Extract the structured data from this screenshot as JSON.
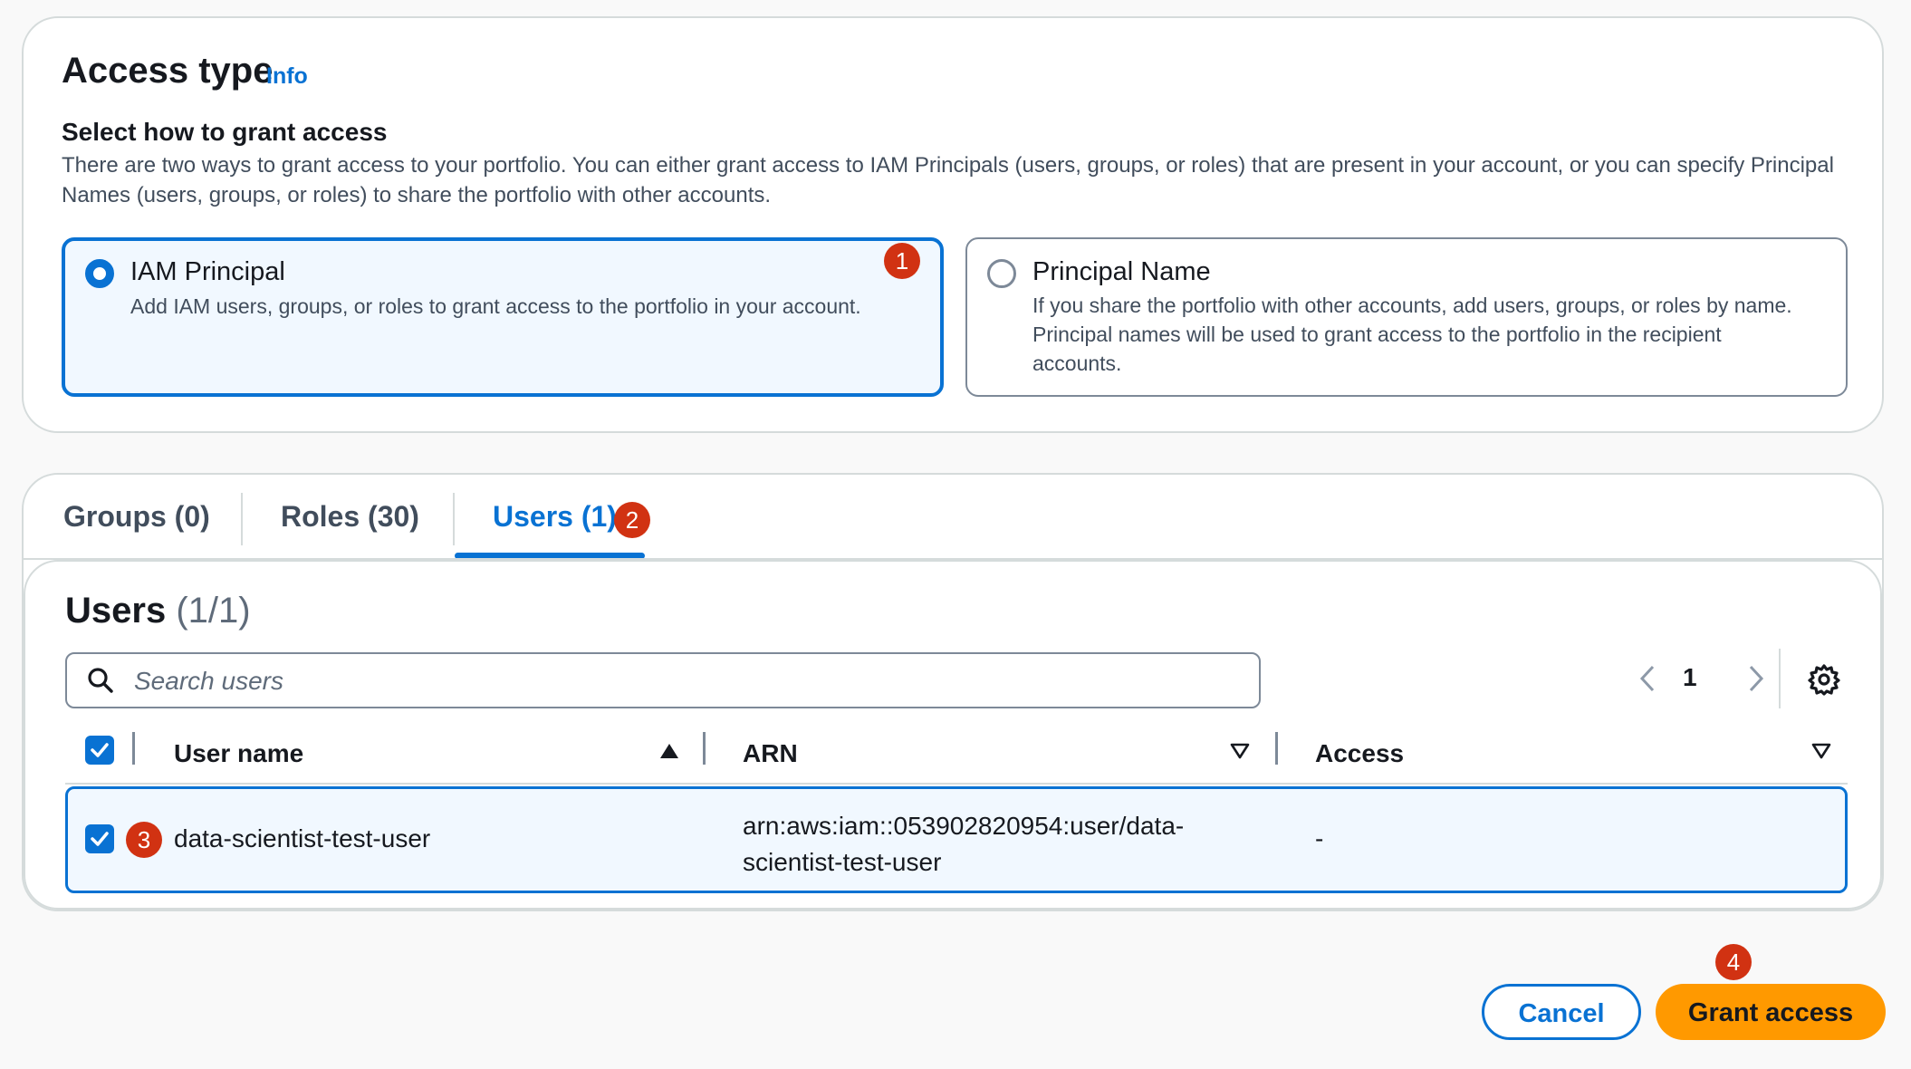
{
  "access_type": {
    "title": "Access type",
    "info_link": "Info",
    "heading": "Select how to grant access",
    "description": "There are two ways to grant access to your portfolio. You can either grant access to IAM Principals (users, groups, or roles) that are present in your account, or you can specify Principal Names (users, groups, or roles) to share the portfolio with other accounts.",
    "options": [
      {
        "label": "IAM Principal",
        "description": "Add IAM users, groups, or roles to grant access to the portfolio in your account.",
        "selected": true
      },
      {
        "label": "Principal Name",
        "description": "If you share the portfolio with other accounts, add users, groups, or roles by name. Principal names will be used to grant access to the portfolio in the recipient accounts.",
        "selected": false
      }
    ]
  },
  "tabs": [
    {
      "label": "Groups (0)",
      "active": false
    },
    {
      "label": "Roles (30)",
      "active": false
    },
    {
      "label": "Users (1)",
      "active": true
    }
  ],
  "users_panel": {
    "title": "Users",
    "count": "(1/1)",
    "search_placeholder": "Search users",
    "search_value": "",
    "page": "1",
    "columns": [
      "User name",
      "ARN",
      "Access"
    ],
    "rows": [
      {
        "selected": true,
        "user_name": "data-scientist-test-user",
        "arn_line1": "arn:aws:iam::053902820954:user/data-",
        "arn_line2": "scientist-test-user",
        "access": "-"
      }
    ]
  },
  "badges": [
    "1",
    "2",
    "3",
    "4"
  ],
  "buttons": {
    "cancel": "Cancel",
    "grant": "Grant access"
  },
  "colors": {
    "accent": "#0972d3",
    "primary_button": "#ff9900",
    "badge": "#d13212"
  }
}
